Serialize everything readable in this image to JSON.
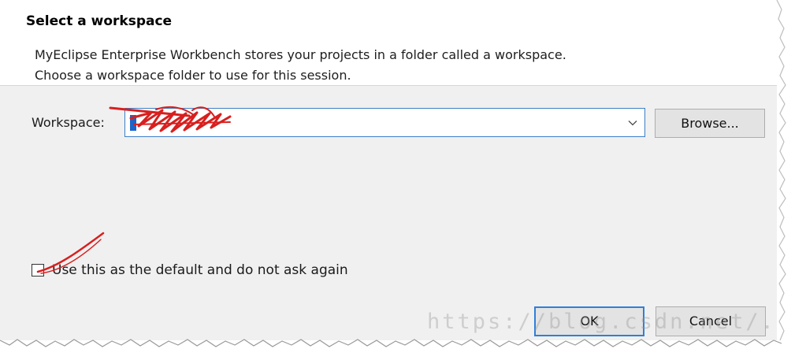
{
  "dialog": {
    "title": "Select a workspace",
    "description_line1": "MyEclipse Enterprise Workbench stores your projects in a folder called a workspace.",
    "description_line2": "Choose a workspace folder to use for this session."
  },
  "workspace": {
    "label": "Workspace:",
    "value": "",
    "dropdown_icon": "chevron-down-icon"
  },
  "buttons": {
    "browse": "Browse...",
    "ok": "OK",
    "cancel": "Cancel"
  },
  "default_checkbox": {
    "label": "Use this as the default and do not ask again",
    "checked": false
  },
  "watermark": "https://blog.csdn.net/...jy",
  "colors": {
    "header_bg": "#ffffff",
    "dialog_bg": "#f0f0f0",
    "accent_border": "#2f7fd9",
    "selection": "#1e64c8",
    "annotation_red": "#d81f1f"
  }
}
